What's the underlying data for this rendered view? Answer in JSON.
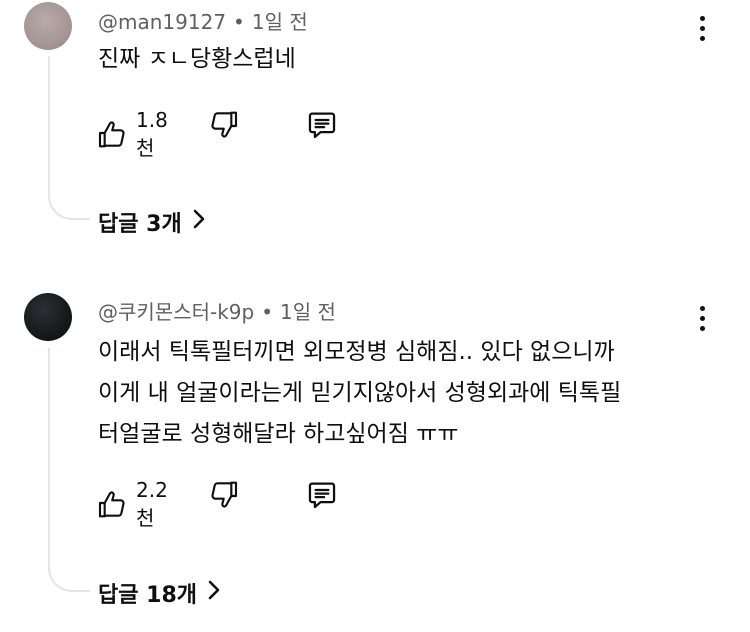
{
  "comments": [
    {
      "author": "@man19127",
      "time": "1일 전",
      "separator": "•",
      "text": "진짜 ㅈㄴ당황스럽네",
      "likes": "1.8천",
      "replies": "답글 3개"
    },
    {
      "author": "@쿠키몬스터-k9p",
      "time": "1일 전",
      "separator": "•",
      "text": "이래서 틱톡필터끼면 외모정병 심해짐.. 있다 없으니까 이게 내 얼굴이라는게 믿기지않아서 성형외과에 틱톡필터얼굴로 성형해달라 하고싶어짐 ㅠㅠ",
      "text_lines": [
        "이래서 틱톡필터끼면 외모정병 심해짐.. 있다 없으니까",
        "이게 내 얼굴이라는게 믿기지않아서 성형외과에 틱톡필",
        "터얼굴로 성형해달라 하고싶어짐 ㅠㅠ"
      ],
      "likes": "2.2천",
      "replies": "답글 18개"
    }
  ],
  "icons": {
    "like": "thumbs-up-icon",
    "dislike": "thumbs-down-icon",
    "reply": "comment-icon",
    "more": "more-vertical-icon",
    "expand": "chevron-right-icon"
  },
  "colors": {
    "text": "#0f0f0f",
    "meta": "#606060",
    "thread_line": "#e5e5e5"
  }
}
